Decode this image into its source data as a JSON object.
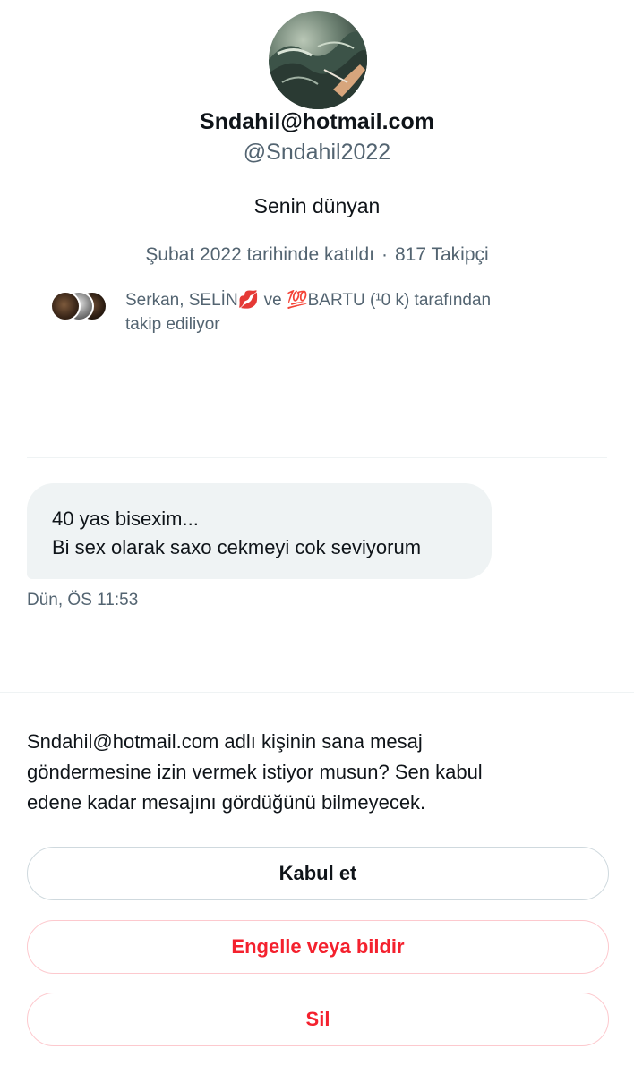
{
  "profile": {
    "display_name": "Sndahil@hotmail.com",
    "handle": "@Sndahil2022",
    "bio": "Senin dünyan",
    "joined": "Şubat 2022 tarihinde katıldı",
    "separator": "·",
    "followers": "817 Takipçi",
    "followed_by_line1": "Serkan, SELİN💋 ve 💯BARTU (¹0 k) tarafından",
    "followed_by_line2": "takip ediliyor"
  },
  "message": {
    "line1": "40 yas bisexim...",
    "line2": "Bi sex olarak saxo cekmeyi cok seviyorum",
    "time": "Dün, ÖS 11:53"
  },
  "request": {
    "text_line1": "Sndahil@hotmail.com adlı kişinin sana mesaj",
    "text_line2": "göndermesine izin vermek istiyor musun? Sen kabul",
    "text_line3": "edene kadar mesajını gördüğünü bilmeyecek."
  },
  "actions": {
    "accept_label": "Kabul et",
    "block_label": "Engelle veya bildir",
    "delete_label": "Sil"
  },
  "colors": {
    "primary_text": "#0f1419",
    "secondary_text": "#536471",
    "danger": "#f4212e",
    "bubble_bg": "#eff3f4"
  }
}
